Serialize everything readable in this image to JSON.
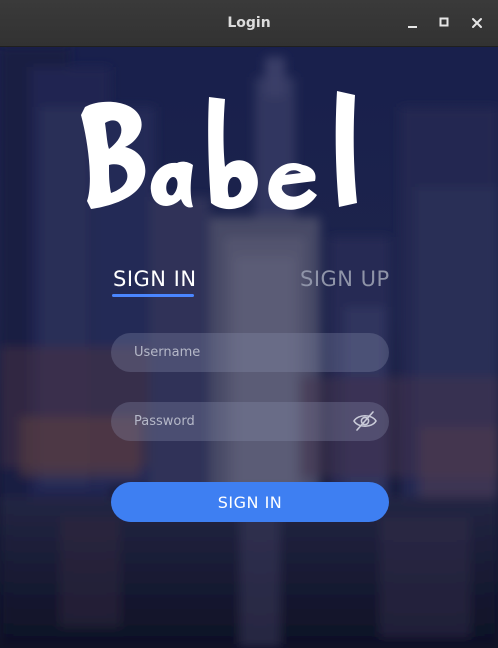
{
  "window": {
    "title": "Login",
    "controls": [
      "minimize-icon",
      "maximize-icon",
      "close-icon"
    ]
  },
  "logo": {
    "text": "Babel"
  },
  "tabs": [
    {
      "label": "SIGN IN",
      "active": true
    },
    {
      "label": "SIGN UP",
      "active": false
    }
  ],
  "form": {
    "username_placeholder": "Username",
    "password_placeholder": "Password",
    "password_toggle_icon": "eye-slash-icon",
    "submit_label": "SIGN IN"
  },
  "colors": {
    "accent": "#3e7ff2",
    "tab_underline": "#4a86ff",
    "inactive_tab": "#8f94a8",
    "titlebar": "#353535"
  }
}
